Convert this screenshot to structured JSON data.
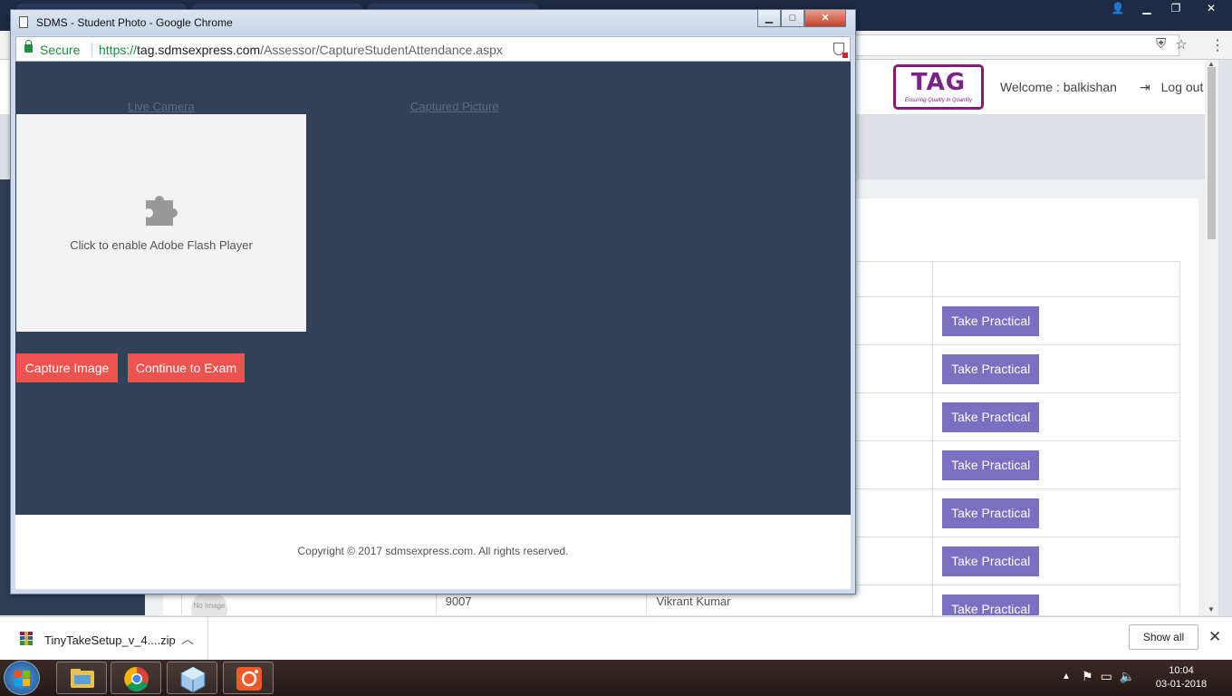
{
  "background_browser": {
    "welcome_text": "Welcome : balkishan",
    "logout_label": "Log out",
    "logo": {
      "text": "TAG",
      "tagline": "Ensuring Quality in Quantity"
    },
    "table_rows": [
      {
        "photo": "",
        "code": "",
        "name": "",
        "action": "Take Practical"
      },
      {
        "photo": "",
        "code": "",
        "name": "",
        "action": "Take Practical"
      },
      {
        "photo": "",
        "code": "",
        "name": "",
        "action": "Take Practical"
      },
      {
        "photo": "",
        "code": "",
        "name": "",
        "action": "Take Practical"
      },
      {
        "photo": "",
        "code": "",
        "name": "",
        "action": "Take Practical"
      },
      {
        "photo": "",
        "code": "",
        "name": "",
        "action": "Take Practical"
      },
      {
        "photo": "No Image",
        "code": "9007",
        "name": "Vikrant Kumar",
        "action": "Take Practical"
      }
    ]
  },
  "popup": {
    "title": "SDMS - Student Photo - Google Chrome",
    "address": {
      "secure_label": "Secure",
      "url_scheme": "https://",
      "url_host": "tag.sdmsexpress.com",
      "url_path": "/Assessor/CaptureStudentAttendance.aspx"
    },
    "tabs": {
      "live_camera": "Live Camera",
      "captured_picture": "Captured Picture"
    },
    "flash_message": "Click to enable Adobe Flash Player",
    "buttons": {
      "capture": "Capture Image",
      "continue": "Continue to Exam"
    },
    "footer": "Copyright © 2017 sdmsexpress.com. All rights reserved."
  },
  "download_bar": {
    "file_name": "TinyTakeSetup_v_4....zip",
    "show_all_label": "Show all"
  },
  "taskbar": {
    "time": "10:04",
    "date": "03-01-2018",
    "apps": [
      "file-explorer-icon",
      "chrome-icon",
      "app-cube-icon",
      "screen-recorder-icon"
    ]
  },
  "colors": {
    "page_dark": "#334158",
    "red_button": "#ef5350",
    "purple_button": "#7b6fc2",
    "secure_green": "#1e8e3e",
    "logo_purple": "#7a2388"
  }
}
